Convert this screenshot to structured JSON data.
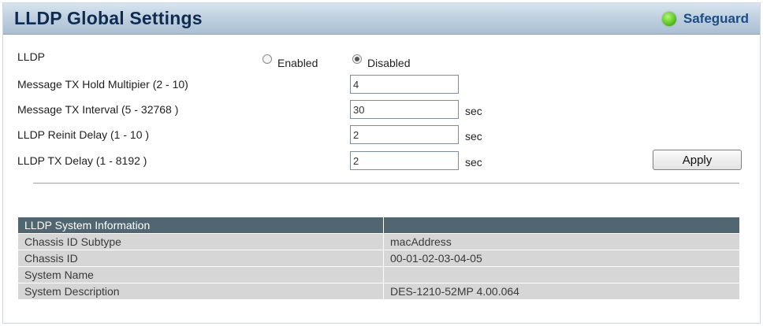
{
  "header": {
    "title": "LLDP Global Settings",
    "safeguard_label": "Safeguard",
    "status_color": "#5ecb1f"
  },
  "settings": {
    "lldp": {
      "label": "LLDP",
      "options": [
        "Enabled",
        "Disabled"
      ],
      "selected": "Disabled"
    },
    "hold_multiplier": {
      "label": "Message TX Hold Multipier (2 - 10)",
      "value": "4"
    },
    "tx_interval": {
      "label": "Message TX Interval (5 - 32768 )",
      "value": "30",
      "unit": "sec"
    },
    "reinit_delay": {
      "label": "LLDP Reinit Delay (1 - 10 )",
      "value": "2",
      "unit": "sec"
    },
    "tx_delay": {
      "label": "LLDP TX Delay (1 - 8192 )",
      "value": "2",
      "unit": "sec"
    },
    "apply_label": "Apply"
  },
  "system_info": {
    "header": "LLDP System Information",
    "rows": [
      {
        "label": "Chassis ID Subtype",
        "value": "macAddress"
      },
      {
        "label": "Chassis ID",
        "value": "00-01-02-03-04-05"
      },
      {
        "label": "System Name",
        "value": ""
      },
      {
        "label": "System Description",
        "value": "DES-1210-52MP 4.00.064"
      }
    ]
  }
}
